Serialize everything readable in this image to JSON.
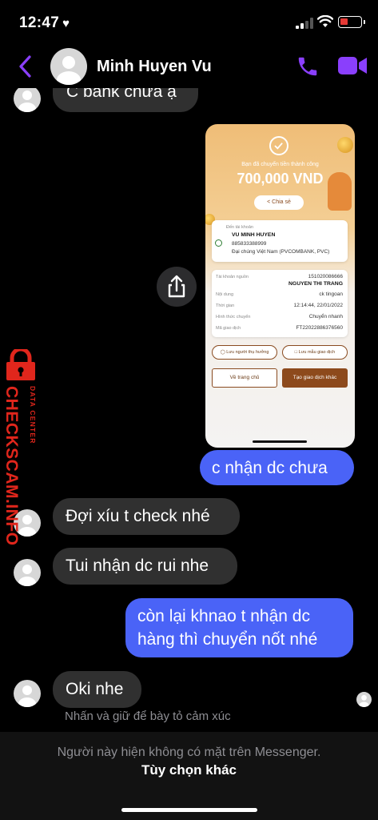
{
  "status_bar": {
    "time": "12:47",
    "heart": "♥",
    "battery_color": "#e53935"
  },
  "header": {
    "contact_name": "Minh Huyen Vu",
    "accent_color": "#8a3ffc"
  },
  "messages": [
    {
      "side": "in",
      "text": "C bank chưa ạ"
    },
    {
      "side": "out",
      "text": "c nhận dc chưa"
    },
    {
      "side": "in",
      "text": "Đợi xíu t check nhé"
    },
    {
      "side": "in",
      "text": "Tui nhận dc rui nhe"
    },
    {
      "side": "out",
      "lines": [
        "còn lại khnao t nhận dc",
        "hàng thì chuyển nốt nhé"
      ]
    },
    {
      "side": "in",
      "text": "Oki nhe"
    }
  ],
  "receipt": {
    "success_text": "Bạn đã chuyển tiền thành công",
    "amount": "700,000 VND",
    "share_label": "Chia sẻ",
    "to_label": "Đến tài khoản",
    "to_name": "VU MINH HUYEN",
    "to_account": "885833388999",
    "to_bank": "Đại chúng Việt Nam (PVCOMBANK, PVC)",
    "rows": [
      {
        "label": "Tài khoản nguồn",
        "value": "151020086666",
        "value2": "NGUYEN THI TRANG"
      },
      {
        "label": "Nội dung",
        "value": "ck tingoan"
      },
      {
        "label": "Thời gian",
        "value": "12:14:44, 22/01/2022"
      },
      {
        "label": "Hình thức chuyển",
        "value": "Chuyển nhanh"
      },
      {
        "label": "Mã giao dịch",
        "value": "FT22022886376560"
      }
    ],
    "save_payee": "Lưu người thụ hưởng",
    "save_template": "Lưu mẫu giao dịch",
    "home_button": "Về trang chủ",
    "new_transaction_button": "Tạo giao dịch khác",
    "brand_color": "#8d4a1c"
  },
  "watermark": {
    "main": "CHECKSCAM.INFO",
    "sub": "DATA CENTER",
    "color": "#e0261c"
  },
  "reaction_hint": "Nhấn và giữ để bày tỏ cảm xúc",
  "footer": {
    "status_text": "Người này hiện không có mặt trên Messenger.",
    "more_options": "Tùy chọn khác"
  },
  "colors": {
    "outgoing_bubble": "#4a63f7",
    "incoming_bubble": "#303030",
    "background": "#000000"
  }
}
